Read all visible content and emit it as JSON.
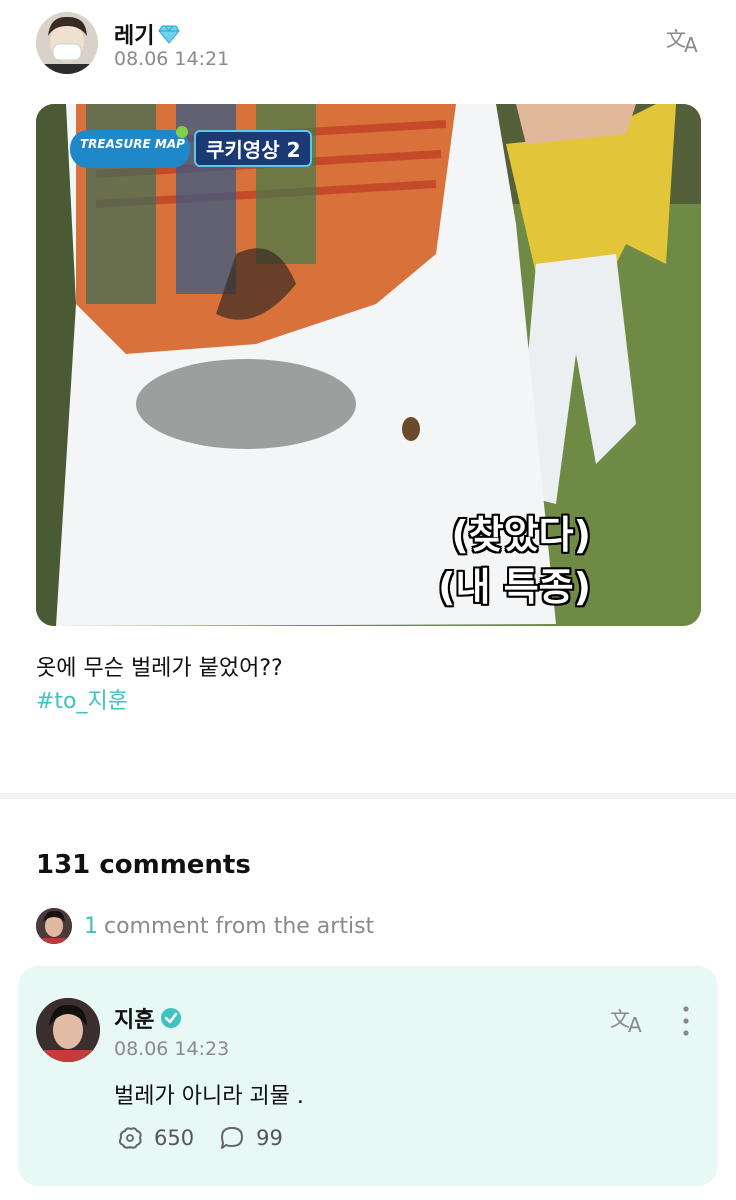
{
  "post": {
    "author": "레기",
    "author_icon": "diamond-icon",
    "timestamp": "08.06 14:21",
    "translate_icon": "translate-icon",
    "image": {
      "show_badge": "TREASURE MAP",
      "episode_badge": "쿠키영상 2",
      "subtitle_line1": "(찾았다)",
      "subtitle_line2": "(내 특종)"
    },
    "text": "옷에 무슨 벌레가 붙었어??",
    "hashtag": "#to_지훈"
  },
  "comments": {
    "count_label": "131 comments",
    "artist_summary": {
      "count": "1",
      "text": "comment from the artist"
    },
    "artist_comment": {
      "author": "지훈",
      "verified_icon": "verified-badge-icon",
      "timestamp": "08.06 14:23",
      "text": "벌레가 아니라 괴물 .",
      "likes": "650",
      "replies": "99"
    }
  },
  "colors": {
    "accent": "#3fc2c2",
    "muted": "#8a8a8a",
    "comment_card_bg": "#e8f8f5"
  }
}
